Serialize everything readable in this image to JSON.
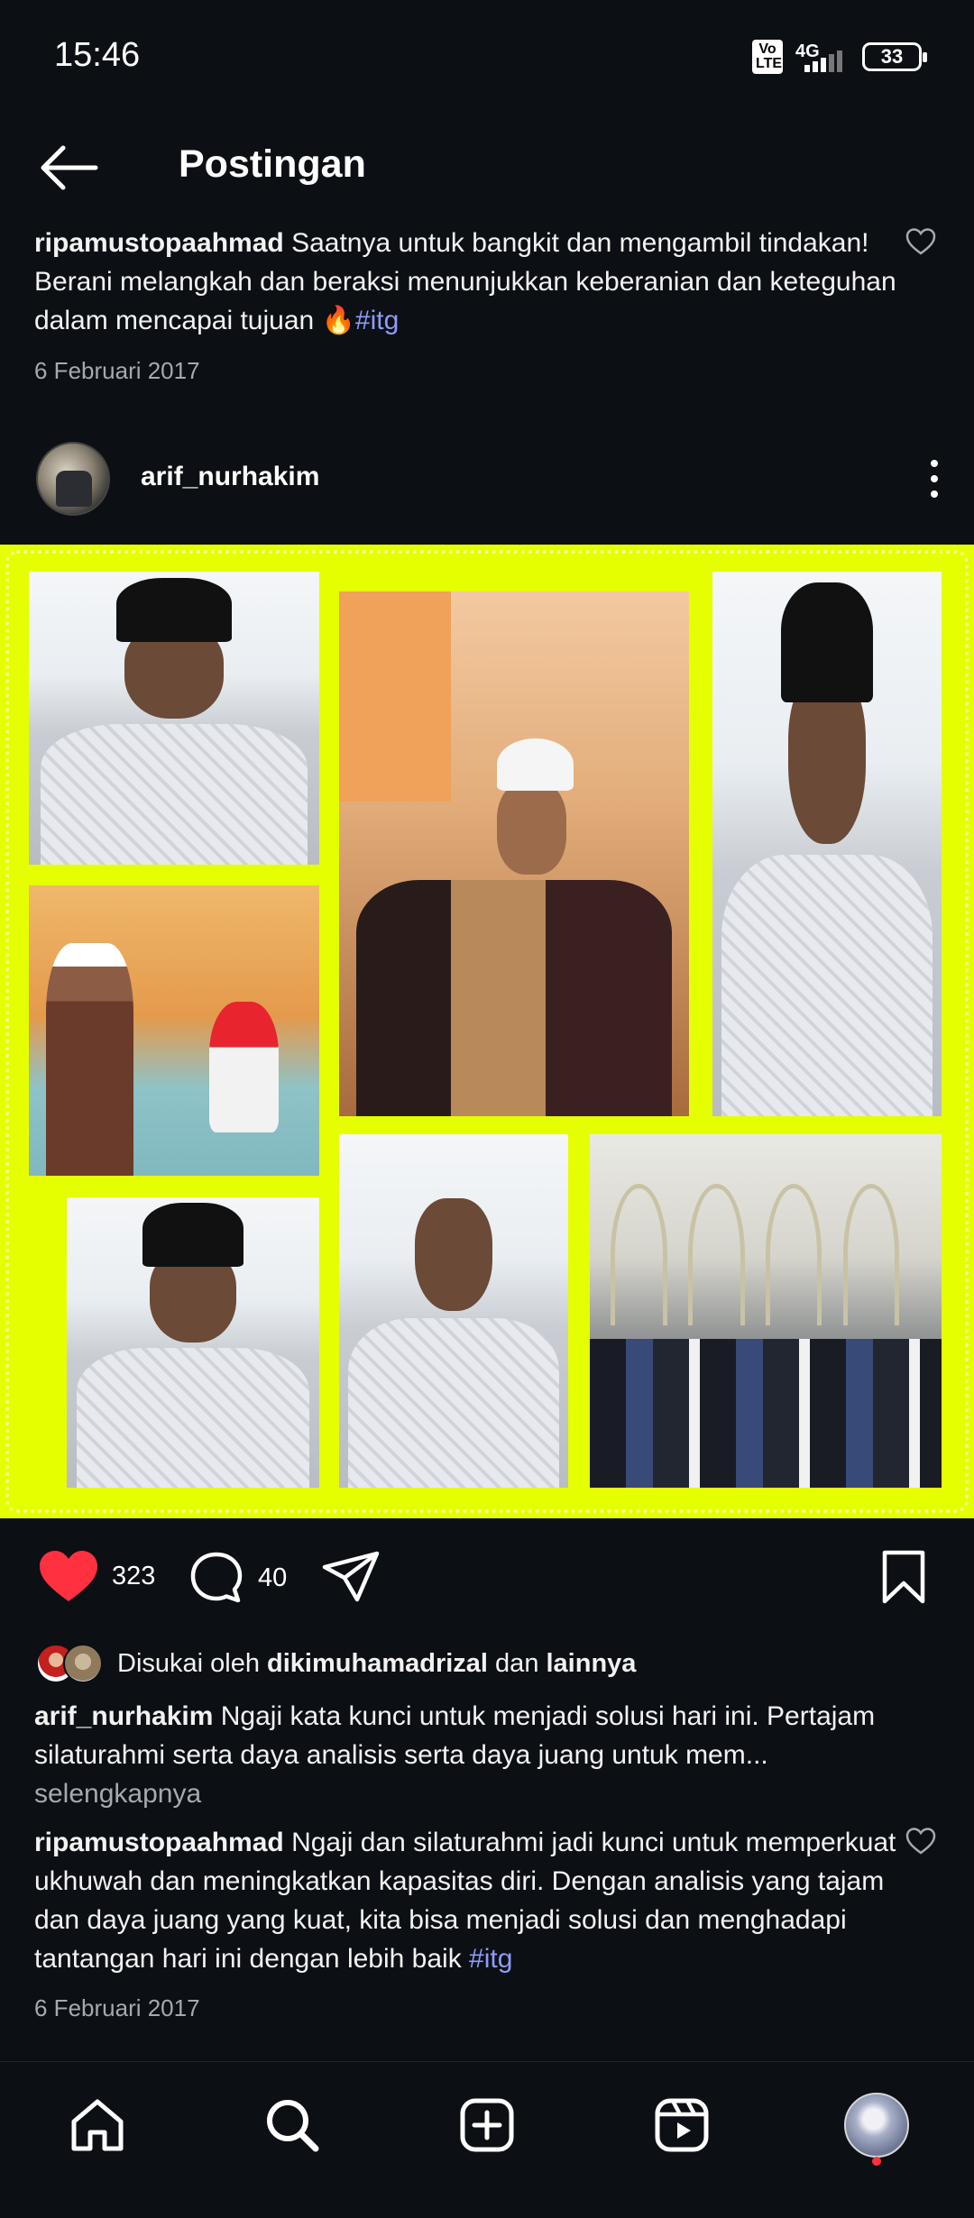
{
  "status_bar": {
    "time": "15:46",
    "volte": "Vo LTE",
    "network": "4G",
    "battery": "33"
  },
  "header": {
    "title": "Postingan"
  },
  "top_comment": {
    "username": "ripamustopaahmad",
    "text": " Saatnya untuk bangkit dan mengambil tindakan! Berani melangkah dan beraksi menunjukkan keberanian dan keteguhan dalam mencapai tujuan ",
    "emoji": "🔥",
    "hashtag": "#itg",
    "date": "6 Februari 2017"
  },
  "post": {
    "author": "arif_nurhakim",
    "likes": "323",
    "comments": "40",
    "liked_by_prefix": "Disukai oleh ",
    "liked_by_user": "dikimuhamadrizal",
    "liked_by_join": " dan ",
    "liked_by_others": "lainnya",
    "caption_user": "arif_nurhakim",
    "caption_text": " Ngaji kata kunci untuk menjadi solusi hari ini.  Pertajam silaturahmi serta daya analisis serta daya juang untuk mem...",
    "caption_more": "selengkapnya"
  },
  "bottom_comment": {
    "username": "ripamustopaahmad",
    "text": " Ngaji dan silaturahmi jadi kunci untuk memperkuat ukhuwah dan meningkatkan kapasitas diri. Dengan analisis yang tajam dan daya juang yang kuat, kita bisa menjadi solusi dan menghadapi tantangan hari ini dengan lebih baik ",
    "hashtag": "#itg",
    "date": "6 Februari 2017"
  },
  "colors": {
    "background": "#0c0f14",
    "like_red": "#ff3040",
    "hashtag": "#8e9cf7",
    "collage_border": "#e6ff00"
  },
  "icons": {
    "back": "arrow-left-icon",
    "like": "heart-filled-icon",
    "comment": "comment-bubble-icon",
    "share": "send-icon",
    "save": "bookmark-icon",
    "home": "home-icon",
    "search": "search-icon",
    "create": "plus-square-icon",
    "reels": "reels-icon"
  }
}
